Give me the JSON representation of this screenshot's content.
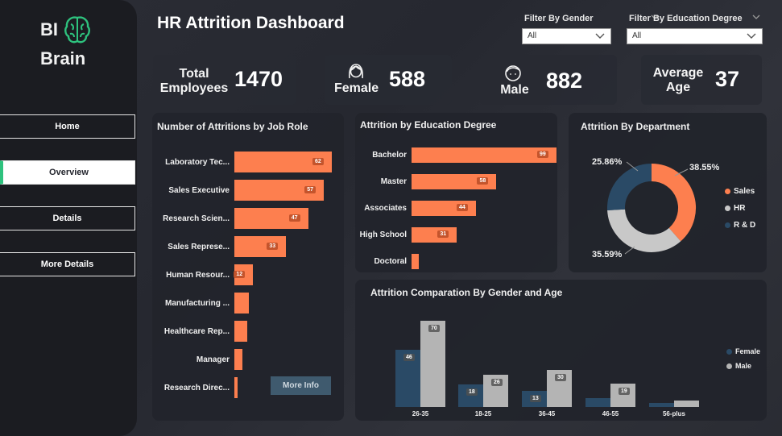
{
  "app": {
    "logo_line1": "BI",
    "logo_line2": "Brain",
    "title": "HR Attrition Dashboard"
  },
  "nav": [
    {
      "label": "Home",
      "active": false
    },
    {
      "label": "Overview",
      "active": true
    },
    {
      "label": "Details",
      "active": false
    },
    {
      "label": "More Details",
      "active": false
    }
  ],
  "filters": {
    "gender": {
      "label": "Filter By Gender",
      "value": "All"
    },
    "education": {
      "label": "Filter By Education Degree",
      "value": "All"
    }
  },
  "kpis": {
    "total": {
      "label_line1": "Total",
      "label_line2": "Employees",
      "value": "1470"
    },
    "female": {
      "label": "Female",
      "value": "588",
      "icon": "female-user-icon"
    },
    "male": {
      "label": "Male",
      "value": "882",
      "icon": "male-user-icon"
    },
    "age": {
      "label_line1": "Average",
      "label_line2": "Age",
      "value": "37"
    }
  },
  "colors": {
    "accent": "#fd7f4f",
    "navy": "#2a4a66",
    "gray": "#b4b4b4",
    "green": "#2ec27e"
  },
  "job_role": {
    "title": "Number of Attritions by Job Role",
    "more_info": "More Info"
  },
  "education": {
    "title": "Attrition by Education Degree"
  },
  "department": {
    "title": "Attrition By Department"
  },
  "gender_age": {
    "title": "Attrition Comparation By Gender and Age"
  },
  "chart_data": [
    {
      "type": "bar",
      "orientation": "horizontal",
      "title": "Number of Attritions by Job Role",
      "categories": [
        "Laboratory Tec...",
        "Sales Executive",
        "Research Scien...",
        "Sales Represe...",
        "Human Resour...",
        "Manufacturing ...",
        "Healthcare Rep...",
        "Manager",
        "Research Direc..."
      ],
      "values": [
        62,
        57,
        47,
        33,
        12,
        9,
        8,
        5,
        2
      ],
      "labels": [
        "62",
        "57",
        "47",
        "33",
        "12",
        "",
        "",
        "",
        ""
      ]
    },
    {
      "type": "bar",
      "orientation": "horizontal",
      "title": "Attrition by Education Degree",
      "categories": [
        "Bachelor",
        "Master",
        "Associates",
        "High School",
        "Doctoral"
      ],
      "values": [
        99,
        58,
        44,
        31,
        5
      ],
      "labels": [
        "99",
        "58",
        "44",
        "31",
        ""
      ]
    },
    {
      "type": "pie",
      "donut": true,
      "title": "Attrition By Department",
      "categories": [
        "Sales",
        "HR",
        "R & D"
      ],
      "values": [
        38.55,
        35.59,
        25.86
      ],
      "labels": [
        "38.55%",
        "35.59%",
        "25.86%"
      ],
      "colors": [
        "#fd7f4f",
        "#c8c8c8",
        "#2a4a66"
      ],
      "legend": "right"
    },
    {
      "type": "bar",
      "title": "Attrition Comparation By Gender and Age",
      "categories": [
        "26-35",
        "18-25",
        "36-45",
        "46-55",
        "56-plus"
      ],
      "series": [
        {
          "name": "Female",
          "values": [
            46,
            18,
            13,
            7,
            3
          ],
          "labels": [
            "46",
            "18",
            "13",
            "",
            ""
          ],
          "color": "#2a4a66"
        },
        {
          "name": "Male",
          "values": [
            70,
            26,
            30,
            19,
            5
          ],
          "labels": [
            "70",
            "26",
            "30",
            "19",
            ""
          ],
          "color": "#b4b4b4"
        }
      ],
      "legend": "right",
      "ylim": [
        0,
        75
      ]
    }
  ]
}
